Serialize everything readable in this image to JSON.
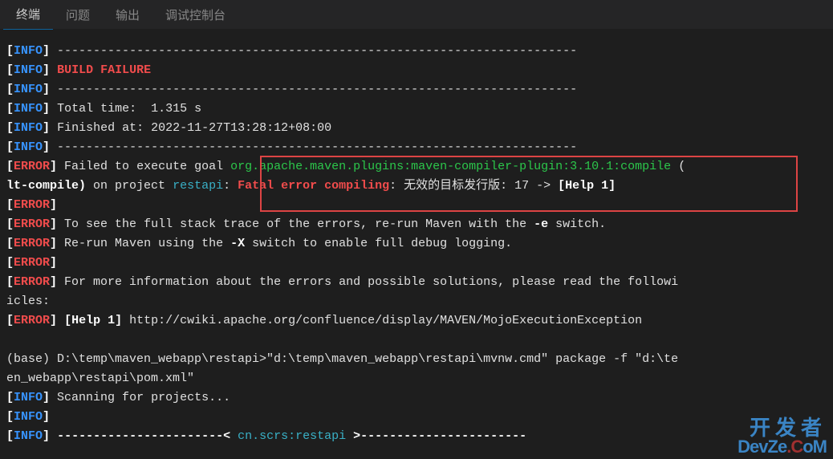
{
  "tabs": {
    "terminal": "终端",
    "problems": "问题",
    "output": "输出",
    "debug_console": "调试控制台"
  },
  "lines": {
    "sep1": " ------------------------------------------------------------------------",
    "build_failure": "BUILD FAILURE",
    "sep2": " ------------------------------------------------------------------------",
    "total_time": "Total time:  1.315 s",
    "finished_at": "Finished at: 2022-11-27T13:28:12+08:00",
    "sep3": " ------------------------------------------------------------------------",
    "error1_pre": " Failed to execute goal ",
    "error1_plugin": "org.apache.maven.plugins:maven-compiler-plugin:3.10.1:compile",
    "error1_trail": " (",
    "error2_pre": "lt-compile)",
    "error2_on": " on project ",
    "error2_project": "restapi",
    "error2_colon": ": ",
    "error2_fatal": "Fatal error compiling",
    "error2_msg": ": 无效的目标发行版: 17 -> ",
    "error2_help": "[Help 1]",
    "error3": "",
    "error4_pre": " To see the full stack trace of the errors, re-run Maven with the ",
    "error4_switch": "-e",
    "error4_post": " switch.",
    "error5_pre": " Re-run Maven using the ",
    "error5_switch": "-X",
    "error5_post": " switch to enable full debug logging.",
    "error6": "",
    "error7": " For more information about the errors and possible solutions, please read the followi",
    "error7_cont": "icles:",
    "error8_pre": " ",
    "error8_help": "[Help 1]",
    "error8_url": " http://cwiki.apache.org/confluence/display/MAVEN/MojoExecutionException",
    "cmd": "(base) D:\\temp\\maven_webapp\\restapi>\"d:\\temp\\maven_webapp\\restapi\\mvnw.cmd\" package -f \"d:\\te",
    "cmd2": "en_webapp\\restapi\\pom.xml\"",
    "scanning": " Scanning for projects...",
    "blank_info": "",
    "project_line_pre": " ",
    "project_line_dash": "-----------------------< ",
    "project_line_name": "cn.scrs:restapi",
    "project_line_dash2": " >-----------------------"
  },
  "watermark": {
    "line1": "开发者",
    "line2a": "D",
    "line2b": "evZ",
    "line2c": "e",
    "line2d": ".C",
    "line2e": "o",
    "line2f": "M"
  }
}
